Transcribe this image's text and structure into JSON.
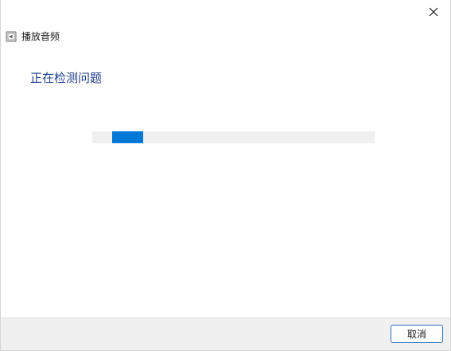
{
  "window": {
    "close_icon": "close-icon"
  },
  "header": {
    "app_icon": "speaker-document-icon",
    "title": "播放音频"
  },
  "main": {
    "heading": "正在检测问题",
    "progress": {
      "style": "indeterminate-marquee",
      "accent_color": "#0078d7",
      "track_color": "#efefef"
    }
  },
  "footer": {
    "cancel_label": "取消"
  },
  "colors": {
    "heading": "#1e3f8f",
    "button_border": "#2b6fb8",
    "footer_bg": "#f0f0f0"
  }
}
